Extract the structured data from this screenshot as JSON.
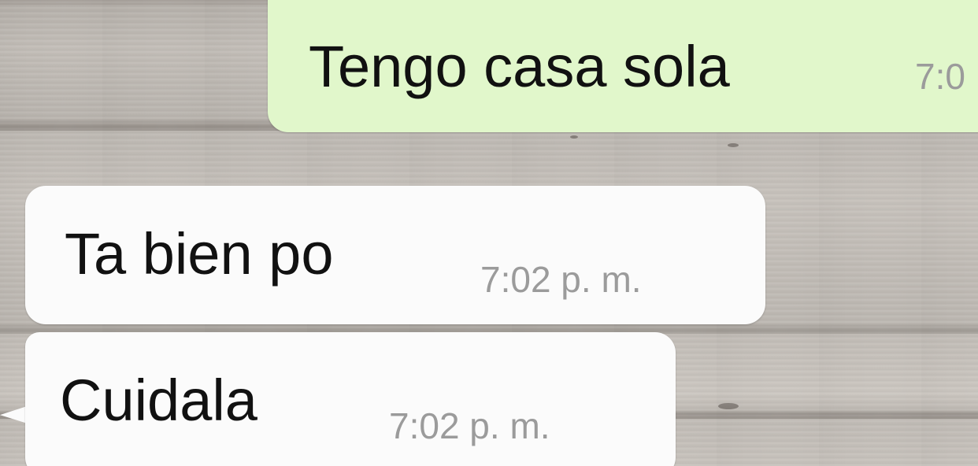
{
  "messages": [
    {
      "direction": "outgoing",
      "text": "Tengo casa sola",
      "time": "7:0"
    },
    {
      "direction": "incoming",
      "text": "Ta bien po",
      "time": "7:02 p. m."
    },
    {
      "direction": "incoming",
      "text": "Cuidala",
      "time": "7:02 p. m."
    }
  ],
  "colors": {
    "outgoing_bubble": "#e1f7cb",
    "incoming_bubble": "#fbfbfb",
    "timestamp": "#9b9b9b",
    "wallpaper": "#b8b3ad"
  }
}
